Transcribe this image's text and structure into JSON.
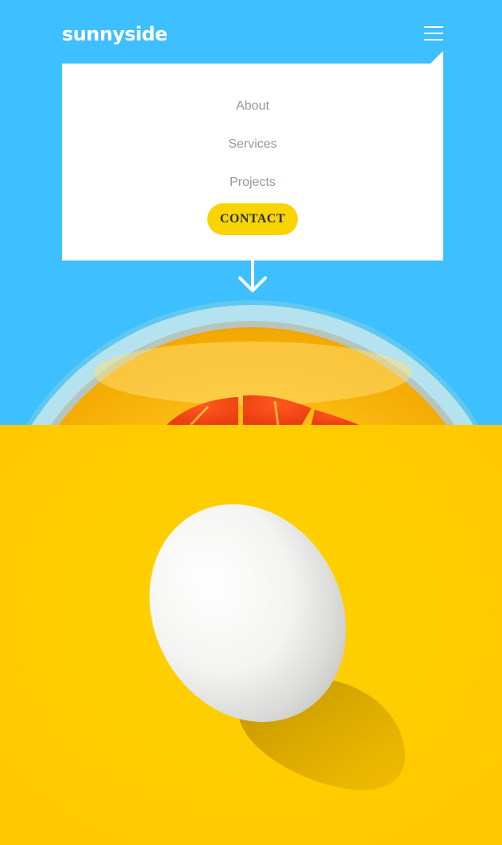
{
  "header": {
    "logo_text": "sunnyside",
    "menu_icon": "hamburger-menu-icon"
  },
  "menu": {
    "items": [
      {
        "label": "About"
      },
      {
        "label": "Services"
      },
      {
        "label": "Projects"
      }
    ],
    "contact_label": "CONTACT"
  },
  "hero": {
    "scroll_icon": "arrow-down-icon",
    "image": "orange-juice-glass-photo"
  },
  "egg_section": {
    "image": "white-egg-photo"
  },
  "colors": {
    "sky_blue": "#3EBFFF",
    "yellow": "#FFD400",
    "menu_text": "#9198A1",
    "button_yellow": "#FAD400",
    "button_text": "#24303F",
    "white": "#FFFFFF"
  }
}
